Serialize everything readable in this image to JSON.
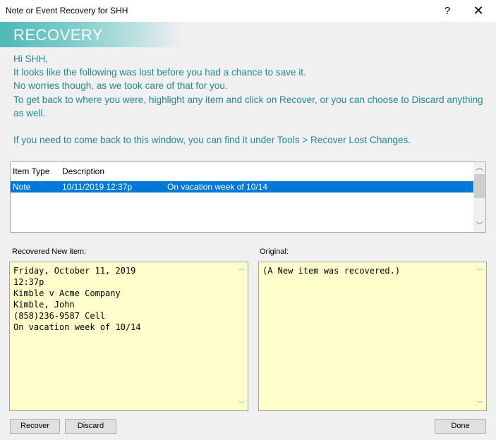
{
  "window": {
    "title": "Note or Event Recovery for SHH",
    "help": "?",
    "close": "✕"
  },
  "banner": {
    "text": "RECOVERY"
  },
  "message": {
    "text": "Hi SHH,\nIt looks like the following was lost before you had a chance to save it.\nNo worries though, as we took care of that for you.\nTo get back to where you were, highlight any item and click on Recover, or you can choose to Discard anything as well.\n\nIf you need to come back to this window, you can find it under Tools > Recover Lost Changes."
  },
  "list": {
    "headers": [
      "Item Type",
      "Description"
    ],
    "rows": [
      {
        "type": "Note",
        "date": "10/11/2019 12:37p",
        "desc": "On vacation week of 10/14"
      }
    ]
  },
  "recovered": {
    "label": "Recovered New item:",
    "text": "Friday, October 11, 2019\n12:37p\nKimble v Acme Company\nKimble, John\n(858)236-9587 Cell\nOn vacation week of 10/14"
  },
  "original": {
    "label": "Original:",
    "text": "(A New item was recovered.)"
  },
  "buttons": {
    "recover": "Recover",
    "discard": "Discard",
    "done": "Done"
  }
}
